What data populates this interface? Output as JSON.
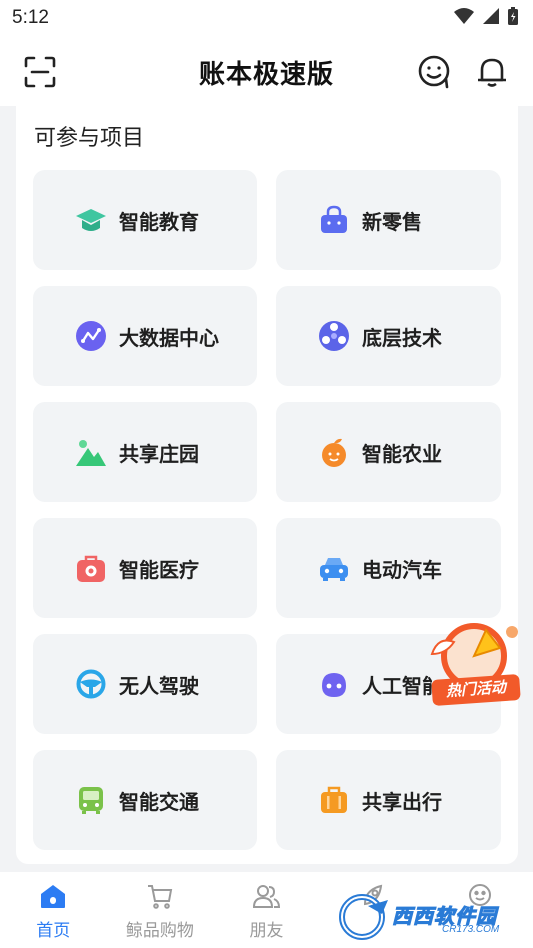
{
  "status_bar": {
    "time": "5:12"
  },
  "header": {
    "title": "账本极速版"
  },
  "section": {
    "title": "可参与项目"
  },
  "cards": [
    {
      "label": "智能教育",
      "icon": "graduation-cap-icon",
      "color": "#3fc6a0"
    },
    {
      "label": "新零售",
      "icon": "shopping-basket-icon",
      "color": "#5b6cf0"
    },
    {
      "label": "大数据中心",
      "icon": "data-chart-icon",
      "color": "#6a62f0"
    },
    {
      "label": "底层技术",
      "icon": "network-globe-icon",
      "color": "#5b64e8"
    },
    {
      "label": "共享庄园",
      "icon": "mountain-icon",
      "color": "#37c778"
    },
    {
      "label": "智能农业",
      "icon": "orange-fruit-icon",
      "color": "#f58a2a"
    },
    {
      "label": "智能医疗",
      "icon": "medical-kit-icon",
      "color": "#f06464"
    },
    {
      "label": "电动汽车",
      "icon": "car-icon",
      "color": "#3d8ff0"
    },
    {
      "label": "无人驾驶",
      "icon": "steering-wheel-icon",
      "color": "#2aa6e8"
    },
    {
      "label": "人工智能",
      "icon": "robot-face-icon",
      "color": "#6f63f0"
    },
    {
      "label": "智能交通",
      "icon": "bus-icon",
      "color": "#7bc24a"
    },
    {
      "label": "共享出行",
      "icon": "suitcase-icon",
      "color": "#f59a22"
    }
  ],
  "promo": {
    "label": "热门活动"
  },
  "bottom_nav": [
    {
      "label": "首页",
      "icon": "home-icon",
      "active": true
    },
    {
      "label": "鲸品购物",
      "icon": "shopping-cart-icon",
      "active": false
    },
    {
      "label": "朋友",
      "icon": "friends-icon",
      "active": false
    },
    {
      "label": "",
      "icon": "rocket-icon",
      "active": false
    },
    {
      "label": "",
      "icon": "profile-icon",
      "active": false
    }
  ],
  "watermark": {
    "text": "西西软件园",
    "sub": "CR173.COM"
  },
  "colors": {
    "accent": "#2c7cf3",
    "promo": "#f25a2a"
  }
}
